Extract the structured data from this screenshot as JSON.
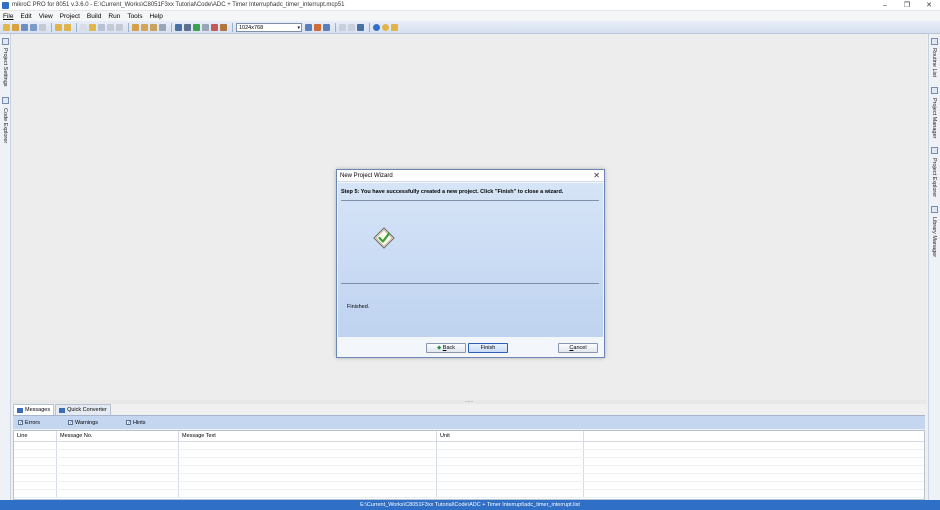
{
  "window": {
    "title": "mikroC PRO for 8051 v.3.6.0 - E:\\Current_Works\\C8051F3xx Tutorial\\Code\\ADC + Timer Interrupt\\adc_timer_interrupt.mcp51",
    "controls": {
      "minimize": "–",
      "restore": "❐",
      "close": "✕"
    }
  },
  "menu": [
    "File",
    "Edit",
    "View",
    "Project",
    "Build",
    "Run",
    "Tools",
    "Help"
  ],
  "toolbar": {
    "resolution": "1024x768",
    "icons": [
      "new-icon",
      "open-icon",
      "save-icon",
      "save-all-icon",
      "close-icon",
      "undo-icon",
      "redo-icon",
      "new-project-icon",
      "open-project-icon",
      "save-project-icon",
      "close-project-icon",
      "edit-project-icon",
      "cut-icon",
      "copy-icon",
      "paste-icon",
      "find-icon",
      "replace-icon",
      "build-icon",
      "build-all-icon",
      "programmer-icon",
      "options-icon",
      "debug-icon",
      "statistics-icon",
      "assembly-icon",
      "listing-icon",
      "help-icon",
      "about-icon",
      "web-icon"
    ]
  },
  "left_dock": {
    "tabs": [
      "Project Settings",
      "Code Explorer"
    ]
  },
  "right_dock": {
    "tabs": [
      "Routine List",
      "Project Manager",
      "Project Explorer",
      "Library Manager"
    ]
  },
  "dialog": {
    "title": "New Project Wizard",
    "close": "✕",
    "step_text": "Step 5: You have successfully created a new project.  Click \"Finish\" to close a wizard.",
    "message": "Finished.",
    "buttons": {
      "back_icon": "◆",
      "back_first": "B",
      "back_rest": "ack",
      "finish": "Finish",
      "cancel_first": "C",
      "cancel_rest": "ancel"
    }
  },
  "messages": {
    "tabs": [
      "Messages",
      "Quick Converter"
    ],
    "filters": [
      {
        "label": "Errors",
        "checked": true
      },
      {
        "label": "Warnings",
        "checked": true
      },
      {
        "label": "Hints",
        "checked": true
      }
    ],
    "columns": [
      "Line",
      "Message No.",
      "Message Text",
      "Unit"
    ],
    "check_mark": "✓",
    "splitter": "......"
  },
  "status": {
    "path": "E:\\Current_Works\\C8051F3xx Tutorial\\Code\\ADC + Timer Interrupt\\adc_timer_interrupt.list"
  },
  "colors": {
    "accent": "#2f6fc6",
    "dialog_gradient_top": "#d6e4f7",
    "dialog_gradient_bottom": "#bfd3f0"
  }
}
